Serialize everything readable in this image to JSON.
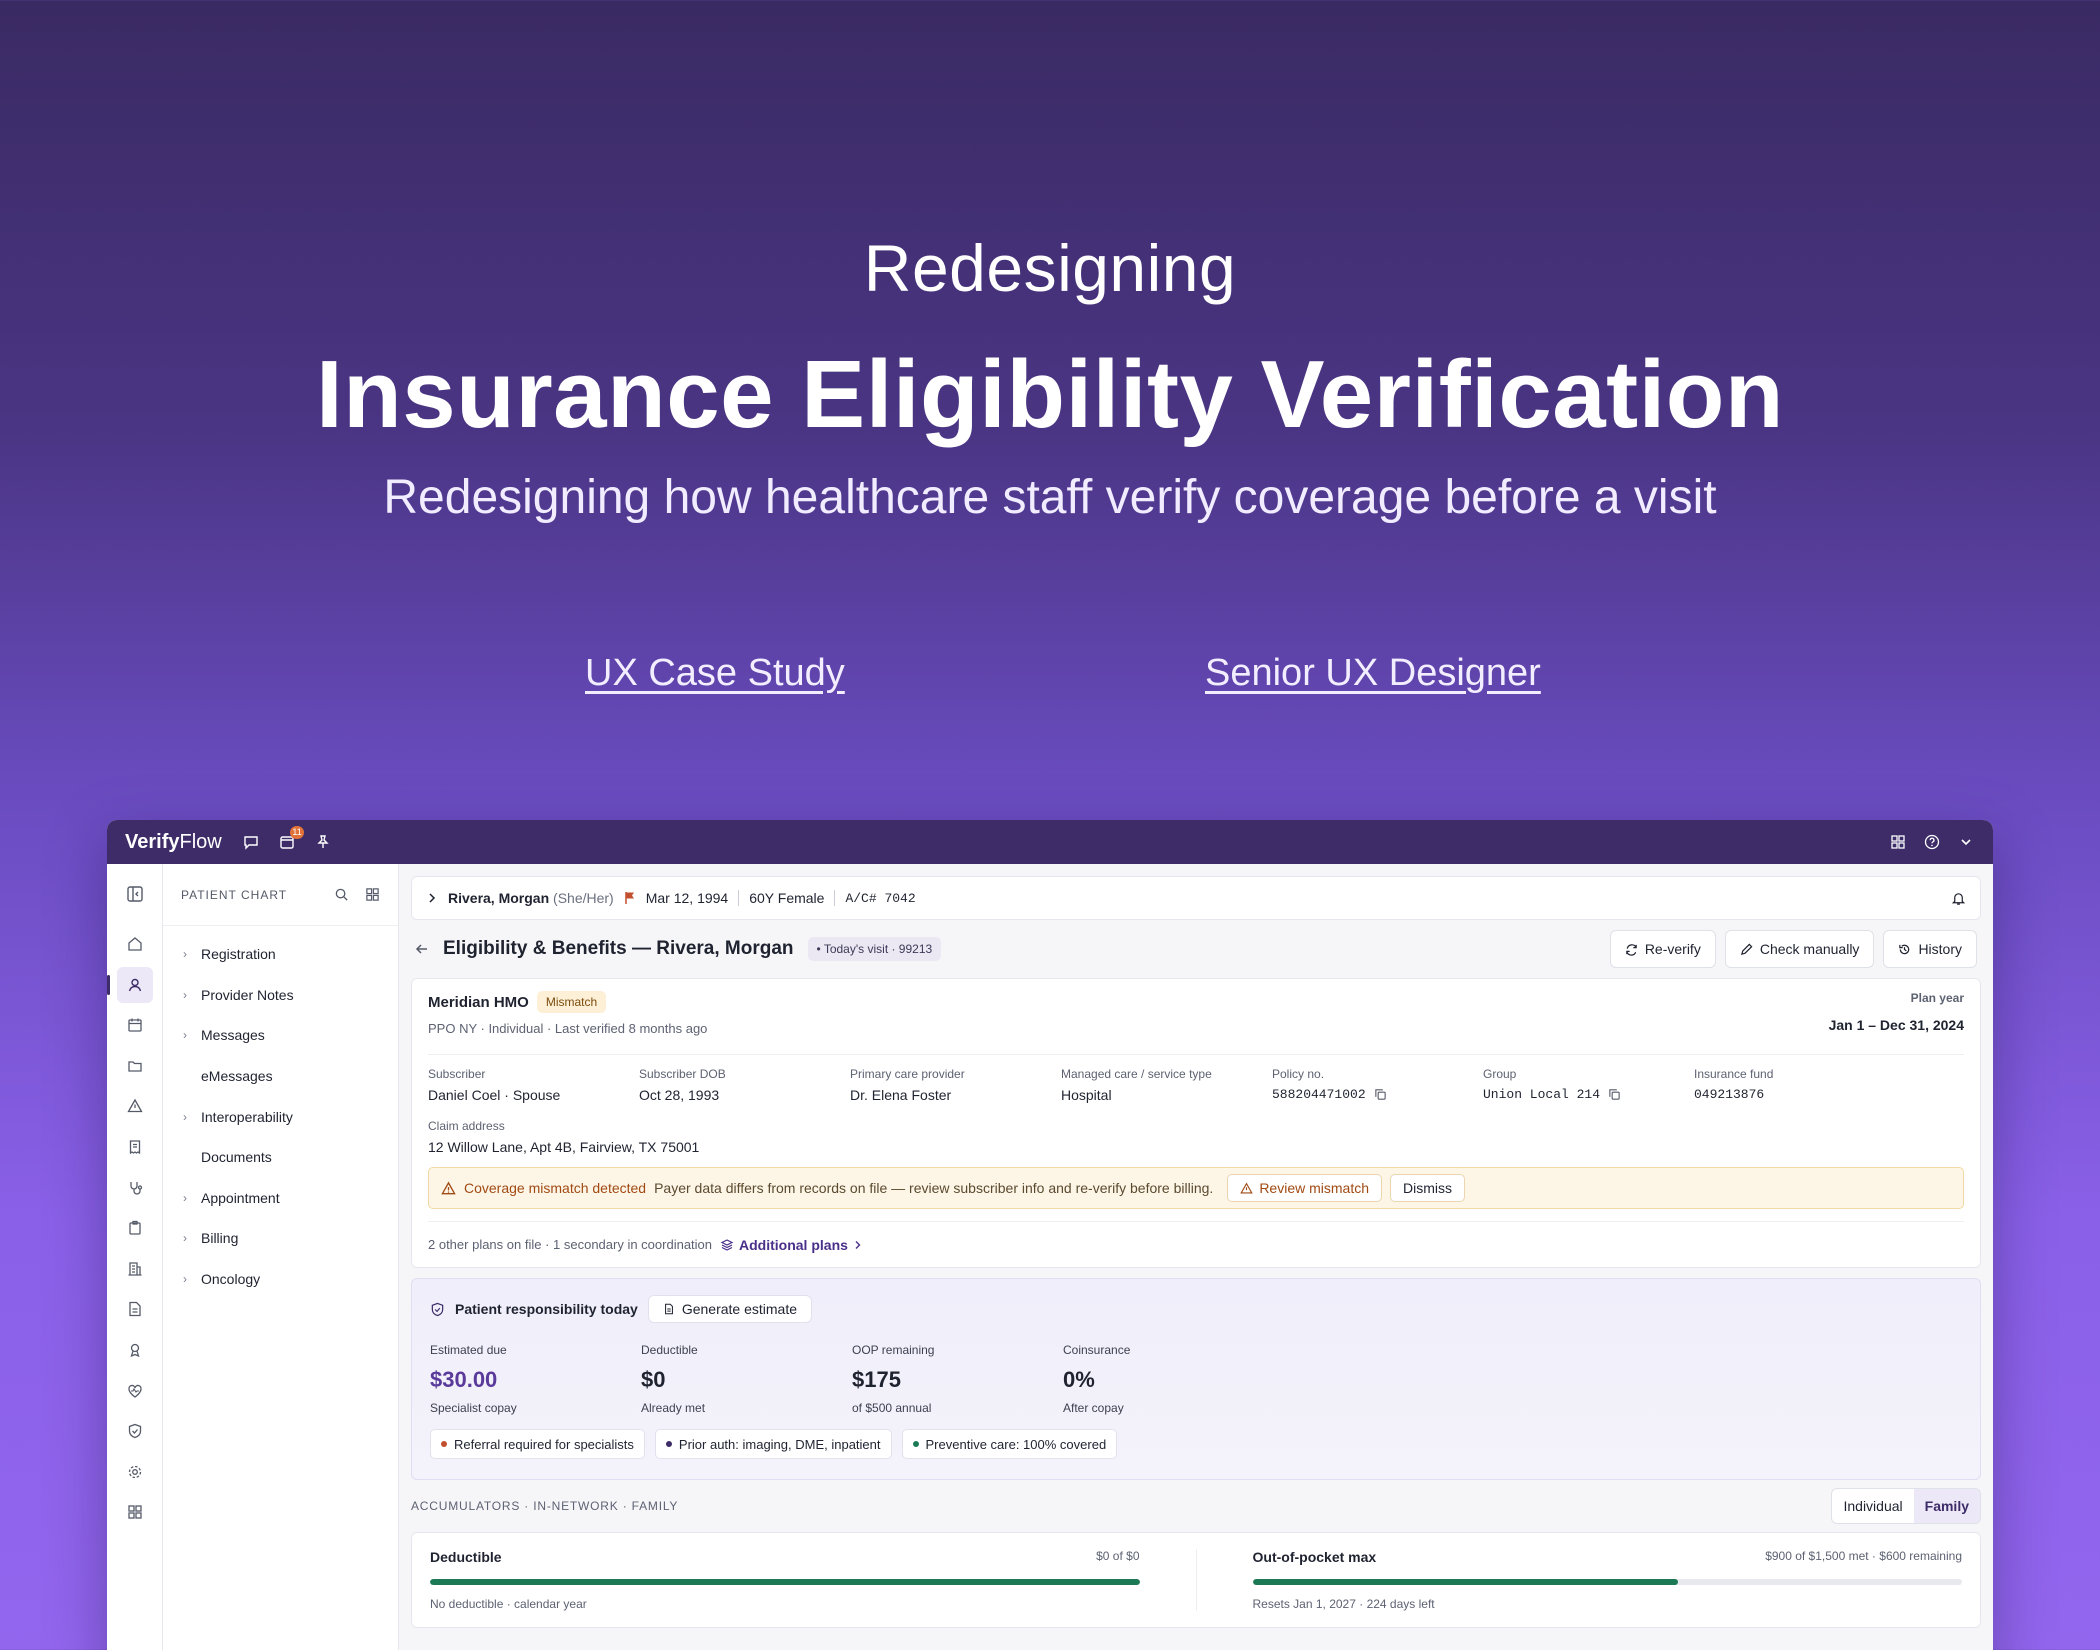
{
  "hero": {
    "kicker": "Redesigning",
    "headline": "Insurance Eligibility Verification",
    "subtitle": "Redesigning how healthcare staff verify coverage before a visit",
    "tag_left": "UX Case Study",
    "tag_right": "Senior UX Designer"
  },
  "app": {
    "brand_bold": "Verify",
    "brand_rest": "Flow",
    "tasks_badge": "11"
  },
  "chart_nav": {
    "title": "PATIENT CHART",
    "items": [
      {
        "label": "Registration",
        "expandable": true
      },
      {
        "label": "Provider Notes",
        "expandable": true
      },
      {
        "label": "Messages",
        "expandable": true
      },
      {
        "label": "eMessages",
        "expandable": false
      },
      {
        "label": "Interoperability",
        "expandable": true
      },
      {
        "label": "Documents",
        "expandable": false
      },
      {
        "label": "Appointment",
        "expandable": true
      },
      {
        "label": "Billing",
        "expandable": true
      },
      {
        "label": "Oncology",
        "expandable": true
      }
    ]
  },
  "patient": {
    "name": "Rivera, Morgan",
    "pronouns": "(She/Her)",
    "dob": "Mar 12, 1994",
    "age_sex": "60Y Female",
    "account": "A/C# 7042"
  },
  "page": {
    "title": "Eligibility & Benefits — Rivera, Morgan",
    "visit_chip": "• Today's visit · 99213",
    "reverify": "Re-verify",
    "check_manually": "Check manually",
    "history": "History"
  },
  "plan": {
    "name": "Meridian HMO",
    "status": "Mismatch",
    "meta": "PPO NY · Individual · Last verified 8 months ago",
    "plan_year_label": "Plan year",
    "plan_year_value": "Jan 1 – Dec 31, 2024",
    "fields": [
      {
        "label": "Subscriber",
        "value": "Daniel Coel · Spouse"
      },
      {
        "label": "Subscriber DOB",
        "value": "Oct 28, 1993"
      },
      {
        "label": "Primary care provider",
        "value": "Dr. Elena Foster"
      },
      {
        "label": "Managed care / service type",
        "value": "Hospital"
      },
      {
        "label": "Policy no.",
        "value": "588204471002"
      },
      {
        "label": "Group",
        "value": "Union Local 214"
      },
      {
        "label": "Insurance fund",
        "value": "049213876"
      }
    ],
    "claim_label": "Claim address",
    "claim_value": "12 Willow Lane, Apt 4B, Fairview, TX 75001",
    "alert_title": "Coverage mismatch detected",
    "alert_msg": "Payer data differs from records on file — review subscriber info and re-verify before billing.",
    "alert_review": "Review mismatch",
    "alert_dismiss": "Dismiss",
    "other_plans": "2 other plans on file · 1 secondary in coordination",
    "additional_plans": "Additional plans"
  },
  "responsibility": {
    "title": "Patient responsibility today",
    "generate": "Generate estimate",
    "metrics": [
      {
        "label": "Estimated due",
        "value": "$30.00",
        "sub": "Specialist copay"
      },
      {
        "label": "Deductible",
        "value": "$0",
        "sub": "Already met"
      },
      {
        "label": "OOP remaining",
        "value": "$175",
        "sub": "of $500 annual"
      },
      {
        "label": "Coinsurance",
        "value": "0%",
        "sub": "After copay"
      }
    ],
    "pills": [
      {
        "label": "Referral required for specialists",
        "color": "#c2502f"
      },
      {
        "label": "Prior auth: imaging, DME, inpatient",
        "color": "#3d2c68"
      },
      {
        "label": "Preventive care: 100% covered",
        "color": "#1b7a55"
      }
    ]
  },
  "accumulators": {
    "heading": "ACCUMULATORS · IN-NETWORK · FAMILY",
    "toggle_individual": "Individual",
    "toggle_family": "Family",
    "items": [
      {
        "title": "Deductible",
        "right": "$0 of $0",
        "progress": 1.0,
        "foot": "No deductible · calendar year"
      },
      {
        "title": "Out-of-pocket max",
        "right": "$900 of $1,500 met · $600 remaining",
        "progress": 0.6,
        "foot": "Resets Jan 1, 2027 · 224 days left"
      }
    ]
  },
  "colors": {
    "titlebar": "#3d2c68",
    "accent": "#5a3a9a",
    "success": "#1b7a55",
    "warning": "#a14a14"
  }
}
